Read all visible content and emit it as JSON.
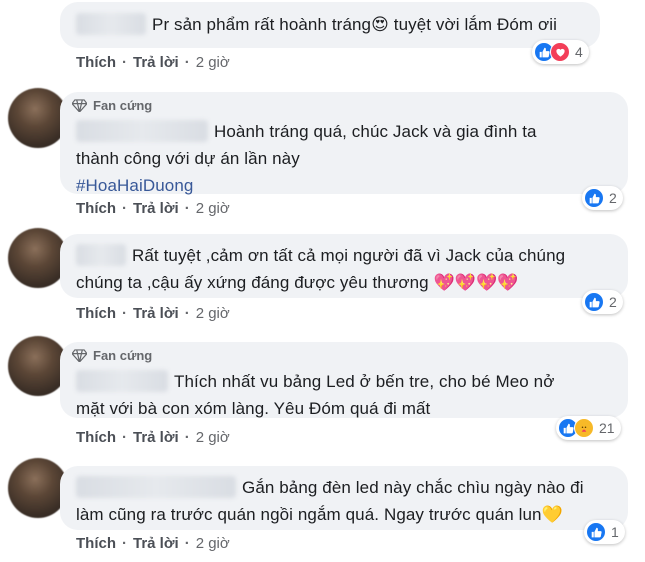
{
  "comments": [
    {
      "badge": "",
      "lines": [
        "Pr sản phẩm rất hoành tráng😍 tuyệt vời lắm Đóm ơii"
      ],
      "actions": {
        "like": "Thích",
        "reply": "Trả lời",
        "time": "2 giờ"
      },
      "reaction_count": "4",
      "reactions": [
        "like-icon",
        "love-icon"
      ]
    },
    {
      "badge": "Fan cứng",
      "lines": [
        "Hoành tráng quá, chúc Jack và gia đình ta",
        "thành công với dự án lần này",
        "#HoaHaiDuong"
      ],
      "actions": {
        "like": "Thích",
        "reply": "Trả lời",
        "time": "2 giờ"
      },
      "reaction_count": "2",
      "reactions": [
        "like-icon"
      ]
    },
    {
      "badge": "",
      "lines": [
        "Rất tuyệt ,cảm ơn tất cả mọi người đã vì Jack của chúng",
        "chúng ta ,cậu ấy xứng đáng được yêu thương 💖💖💖💖"
      ],
      "actions": {
        "like": "Thích",
        "reply": "Trả lời",
        "time": "2 giờ"
      },
      "reaction_count": "2",
      "reactions": [
        "like-icon"
      ]
    },
    {
      "badge": "Fan cứng",
      "lines": [
        "Thích nhất vu bảng Led ở bến tre, cho bé Meo nở",
        "mặt với bà con xóm làng. Yêu Đóm quá đi mất"
      ],
      "actions": {
        "like": "Thích",
        "reply": "Trả lời",
        "time": "2 giờ"
      },
      "reaction_count": "21",
      "reactions": [
        "like-icon",
        "care-icon"
      ]
    },
    {
      "badge": "",
      "lines": [
        "Gắn bảng đèn led này chắc chìu ngày nào đi",
        "làm cũng ra trước quán ngồi ngắm quá. Ngay trước quán lun💛"
      ],
      "actions": {
        "like": "Thích",
        "reply": "Trả lời",
        "time": "2 giờ"
      },
      "reaction_count": "1",
      "reactions": [
        "like-icon"
      ]
    }
  ],
  "colors": {
    "bubble": "#f0f2f5",
    "like": "#1877f2",
    "love": "#f33e58",
    "hashtag": "#385898"
  }
}
